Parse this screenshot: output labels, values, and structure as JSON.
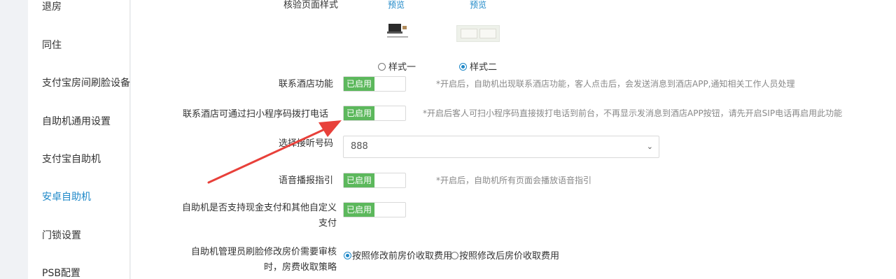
{
  "sidebar": {
    "items": [
      {
        "label": "退房"
      },
      {
        "label": "同住"
      },
      {
        "label": "支付宝房间刷脸设备"
      },
      {
        "label": "自助机通用设置"
      },
      {
        "label": "支付宝自助机"
      },
      {
        "label": "安卓自助机",
        "active": true
      },
      {
        "label": "门锁设置"
      },
      {
        "label": "PSB配置"
      }
    ]
  },
  "verify_style": {
    "label": "核验页面样式",
    "preview1": "预览",
    "preview2": "预览",
    "option1": "样式一",
    "option2": "样式二",
    "selected": "样式二"
  },
  "contact_hotel": {
    "label": "联系酒店功能",
    "toggle_label": "已启用",
    "hint": "*开启后，自助机出现联系酒店功能，客人点击后，会发送消息到酒店APP,通知相关工作人员处理"
  },
  "contact_phone": {
    "label": "联系酒店可通过扫小程序码拨打电话",
    "toggle_label": "已启用",
    "hint": "*开启后客人可扫小程序码直接拨打电话到前台，不再显示发消息到酒店APP按钮，请先开启SIP电话再启用此功能"
  },
  "answer_number": {
    "label": "选择接听号码",
    "value": "888"
  },
  "voice_guide": {
    "label": "语音播报指引",
    "toggle_label": "已启用",
    "hint": "*开启后，自助机所有页面会播放语音指引"
  },
  "cash_payment": {
    "label": "自助机是否支持现金支付和其他自定义支付",
    "toggle_label": "已启用"
  },
  "price_review": {
    "label": "自助机管理员刷脸修改房价需要审核时，房费收取策略",
    "option1": "按照修改前房价收取费用",
    "option2": "按照修改后房价收取费用",
    "selected": "按照修改前房价收取费用"
  },
  "colors": {
    "accent": "#1e88c8",
    "toggle_on": "#5cb85c",
    "arrow": "#e8403a"
  }
}
